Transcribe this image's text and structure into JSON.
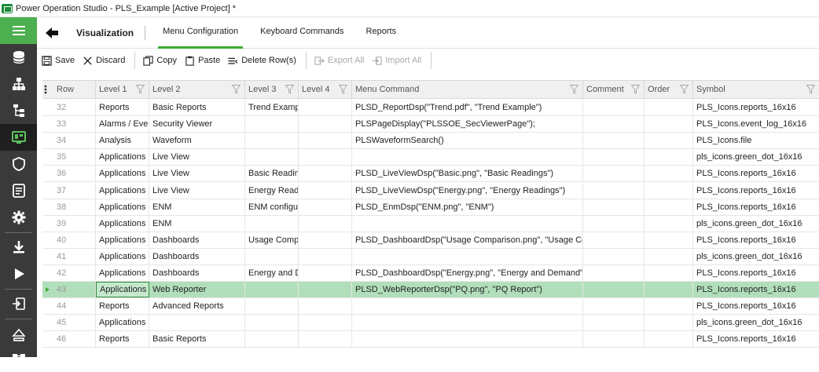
{
  "window": {
    "title": "Power Operation Studio - PLS_Example [Active Project] *"
  },
  "rail": {
    "items": [
      {
        "name": "hamburger-menu-icon"
      },
      {
        "name": "database-icon"
      },
      {
        "name": "hierarchy-icon"
      },
      {
        "name": "tree-icon"
      },
      {
        "name": "visualization-icon"
      },
      {
        "name": "shield-icon"
      },
      {
        "name": "document-icon"
      },
      {
        "name": "gear-icon"
      },
      {
        "name": "download-icon"
      },
      {
        "name": "play-icon"
      },
      {
        "name": "export-icon"
      },
      {
        "name": "upgrade-icon"
      },
      {
        "name": "network-icon"
      }
    ]
  },
  "header": {
    "section_title": "Visualization",
    "tabs": [
      {
        "label": "Menu Configuration",
        "active": true
      },
      {
        "label": "Keyboard Commands",
        "active": false
      },
      {
        "label": "Reports",
        "active": false
      }
    ]
  },
  "toolbar": {
    "save": "Save",
    "discard": "Discard",
    "copy": "Copy",
    "paste": "Paste",
    "delete_rows": "Delete Row(s)",
    "export_all": "Export All",
    "import_all": "Import All"
  },
  "grid": {
    "columns": [
      {
        "label": "Row",
        "filter": false
      },
      {
        "label": "Level 1",
        "filter": true
      },
      {
        "label": "Level 2",
        "filter": true
      },
      {
        "label": "Level 3",
        "filter": true
      },
      {
        "label": "Level 4",
        "filter": true
      },
      {
        "label": "Menu Command",
        "filter": true
      },
      {
        "label": "Comment",
        "filter": true
      },
      {
        "label": "Order",
        "filter": true
      },
      {
        "label": "Symbol",
        "filter": true
      }
    ],
    "rows": [
      {
        "row": "32",
        "l1": "Reports",
        "l2": "Basic Reports",
        "l3": "Trend Example",
        "l4": "",
        "cmd": "PLSD_ReportDsp(\"Trend.pdf\", \"Trend Example\")",
        "comment": "",
        "order": "",
        "symbol": "PLS_Icons.reports_16x16"
      },
      {
        "row": "33",
        "l1": "Alarms / Events",
        "l2": "Security Viewer",
        "l3": "",
        "l4": "",
        "cmd": "PLSPageDisplay(\"PLSSOE_SecViewerPage\");",
        "comment": "",
        "order": "",
        "symbol": "PLS_Icons.event_log_16x16"
      },
      {
        "row": "34",
        "l1": "Analysis",
        "l2": "Waveform",
        "l3": "",
        "l4": "",
        "cmd": "PLSWaveformSearch()",
        "comment": "",
        "order": "",
        "symbol": "PLS_Icons.file"
      },
      {
        "row": "35",
        "l1": "Applications",
        "l2": "Live View",
        "l3": "",
        "l4": "",
        "cmd": "",
        "comment": "",
        "order": "",
        "symbol": "pls_icons.green_dot_16x16"
      },
      {
        "row": "36",
        "l1": "Applications",
        "l2": "Live View",
        "l3": "Basic Readings",
        "l4": "",
        "cmd": "PLSD_LiveViewDsp(\"Basic.png\", \"Basic Readings\")",
        "comment": "",
        "order": "",
        "symbol": "PLS_Icons.reports_16x16"
      },
      {
        "row": "37",
        "l1": "Applications",
        "l2": "Live View",
        "l3": "Energy Readings",
        "l4": "",
        "cmd": "PLSD_LiveViewDsp(\"Energy.png\", \"Energy Readings\")",
        "comment": "",
        "order": "",
        "symbol": "PLS_Icons.reports_16x16"
      },
      {
        "row": "38",
        "l1": "Applications",
        "l2": "ENM",
        "l3": "ENM configuration",
        "l4": "",
        "cmd": "PLSD_EnmDsp(\"ENM.png\", \"ENM\")",
        "comment": "",
        "order": "",
        "symbol": "PLS_Icons.reports_16x16"
      },
      {
        "row": "39",
        "l1": "Applications",
        "l2": "ENM",
        "l3": "",
        "l4": "",
        "cmd": "",
        "comment": "",
        "order": "",
        "symbol": "pls_icons.green_dot_16x16"
      },
      {
        "row": "40",
        "l1": "Applications",
        "l2": "Dashboards",
        "l3": "Usage Comparison",
        "l4": "",
        "cmd": "PLSD_DashboardDsp(\"Usage Comparison.png\", \"Usage Comparison\")",
        "comment": "",
        "order": "",
        "symbol": "PLS_Icons.reports_16x16"
      },
      {
        "row": "41",
        "l1": "Applications",
        "l2": "Dashboards",
        "l3": "",
        "l4": "",
        "cmd": "",
        "comment": "",
        "order": "",
        "symbol": "pls_icons.green_dot_16x16"
      },
      {
        "row": "42",
        "l1": "Applications",
        "l2": "Dashboards",
        "l3": "Energy and Demand",
        "l4": "",
        "cmd": "PLSD_DashboardDsp(\"Energy.png\", \"Energy and Demand\")",
        "comment": "",
        "order": "",
        "symbol": "PLS_Icons.reports_16x16"
      },
      {
        "row": "43",
        "l1": "Applications",
        "l2": "Web Reporter",
        "l3": "",
        "l4": "",
        "cmd": "PLSD_WebReporterDsp(\"PQ.png\", \"PQ Report\")",
        "comment": "",
        "order": "",
        "symbol": "PLS_Icons.reports_16x16",
        "selected": true
      },
      {
        "row": "44",
        "l1": "Reports",
        "l2": "Advanced Reports",
        "l3": "",
        "l4": "",
        "cmd": "",
        "comment": "",
        "order": "",
        "symbol": "PLS_Icons.reports_16x16"
      },
      {
        "row": "45",
        "l1": "Applications",
        "l2": "",
        "l3": "",
        "l4": "",
        "cmd": "",
        "comment": "",
        "order": "",
        "symbol": "pls_icons.green_dot_16x16"
      },
      {
        "row": "46",
        "l1": "Reports",
        "l2": "Basic Reports",
        "l3": "",
        "l4": "",
        "cmd": "",
        "comment": "",
        "order": "",
        "symbol": "PLS_Icons.reports_16x16"
      }
    ]
  },
  "colors": {
    "accent": "#3aaa35",
    "rail_bg": "#3a3a3a",
    "rail_active": "#4caf50",
    "selected_row": "#b2dfbb"
  }
}
